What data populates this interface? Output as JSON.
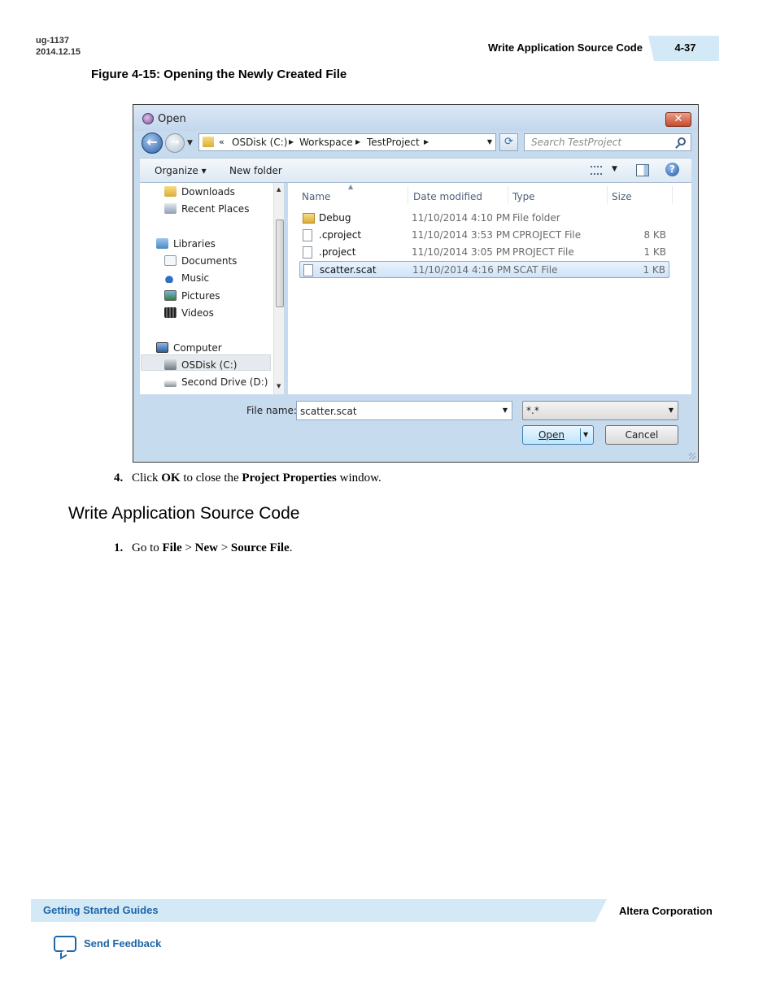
{
  "header": {
    "doc_id": "ug-1137",
    "doc_date": "2014.12.15",
    "section_title": "Write Application Source Code",
    "page_number": "4-37"
  },
  "figure": {
    "caption": "Figure 4-15: Opening the Newly Created File"
  },
  "dialog": {
    "title": "Open",
    "close_glyph": "✕",
    "address": {
      "overflow": "«",
      "crumbs": [
        "OSDisk (C:)",
        "Workspace",
        "TestProject"
      ]
    },
    "search_placeholder": "Search TestProject",
    "toolbar": {
      "organize": "Organize ▾",
      "new_folder": "New folder",
      "help": "?"
    },
    "nav_items": [
      {
        "label": "Downloads",
        "icon": "downloads-icon"
      },
      {
        "label": "Recent Places",
        "icon": "recent-places-icon"
      },
      {
        "label": "Libraries",
        "icon": "libraries-icon"
      },
      {
        "label": "Documents",
        "icon": "documents-icon"
      },
      {
        "label": "Music",
        "icon": "music-icon"
      },
      {
        "label": "Pictures",
        "icon": "pictures-icon"
      },
      {
        "label": "Videos",
        "icon": "videos-icon"
      },
      {
        "label": "Computer",
        "icon": "computer-icon"
      },
      {
        "label": "OSDisk (C:)",
        "icon": "osdisk-icon",
        "selected": true
      },
      {
        "label": "Second Drive (D:)",
        "icon": "drive-icon"
      }
    ],
    "columns": [
      "Name",
      "Date modified",
      "Type",
      "Size"
    ],
    "files": [
      {
        "name": "Debug",
        "date": "11/10/2014 4:10 PM",
        "type": "File folder",
        "size": "",
        "folder": true
      },
      {
        "name": ".cproject",
        "date": "11/10/2014 3:53 PM",
        "type": "CPROJECT File",
        "size": "8 KB"
      },
      {
        "name": ".project",
        "date": "11/10/2014 3:05 PM",
        "type": "PROJECT File",
        "size": "1 KB"
      },
      {
        "name": "scatter.scat",
        "date": "11/10/2014 4:16 PM",
        "type": "SCAT File",
        "size": "1 KB",
        "selected": true
      }
    ],
    "file_name_label": "File name:",
    "file_name_value": "scatter.scat",
    "file_type_value": "*.*",
    "open_label": "Open",
    "cancel_label": "Cancel"
  },
  "steps": {
    "step4": {
      "number": "4.",
      "p1": "Click ",
      "b1": "OK",
      "p2": " to close the ",
      "b2": "Project Properties",
      "p3": " window."
    },
    "heading": "Write Application Source Code",
    "step1": {
      "number": "1.",
      "p1": "Go to ",
      "b1": "File",
      "p2": " > ",
      "b2": "New",
      "p3": " > ",
      "b3": "Source File",
      "p4": "."
    }
  },
  "footer": {
    "guides": "Getting Started Guides",
    "corporation": "Altera Corporation",
    "feedback": "Send Feedback"
  },
  "colors": {
    "accent_band": "#d4e9f6",
    "link_blue": "#1e66a8"
  }
}
